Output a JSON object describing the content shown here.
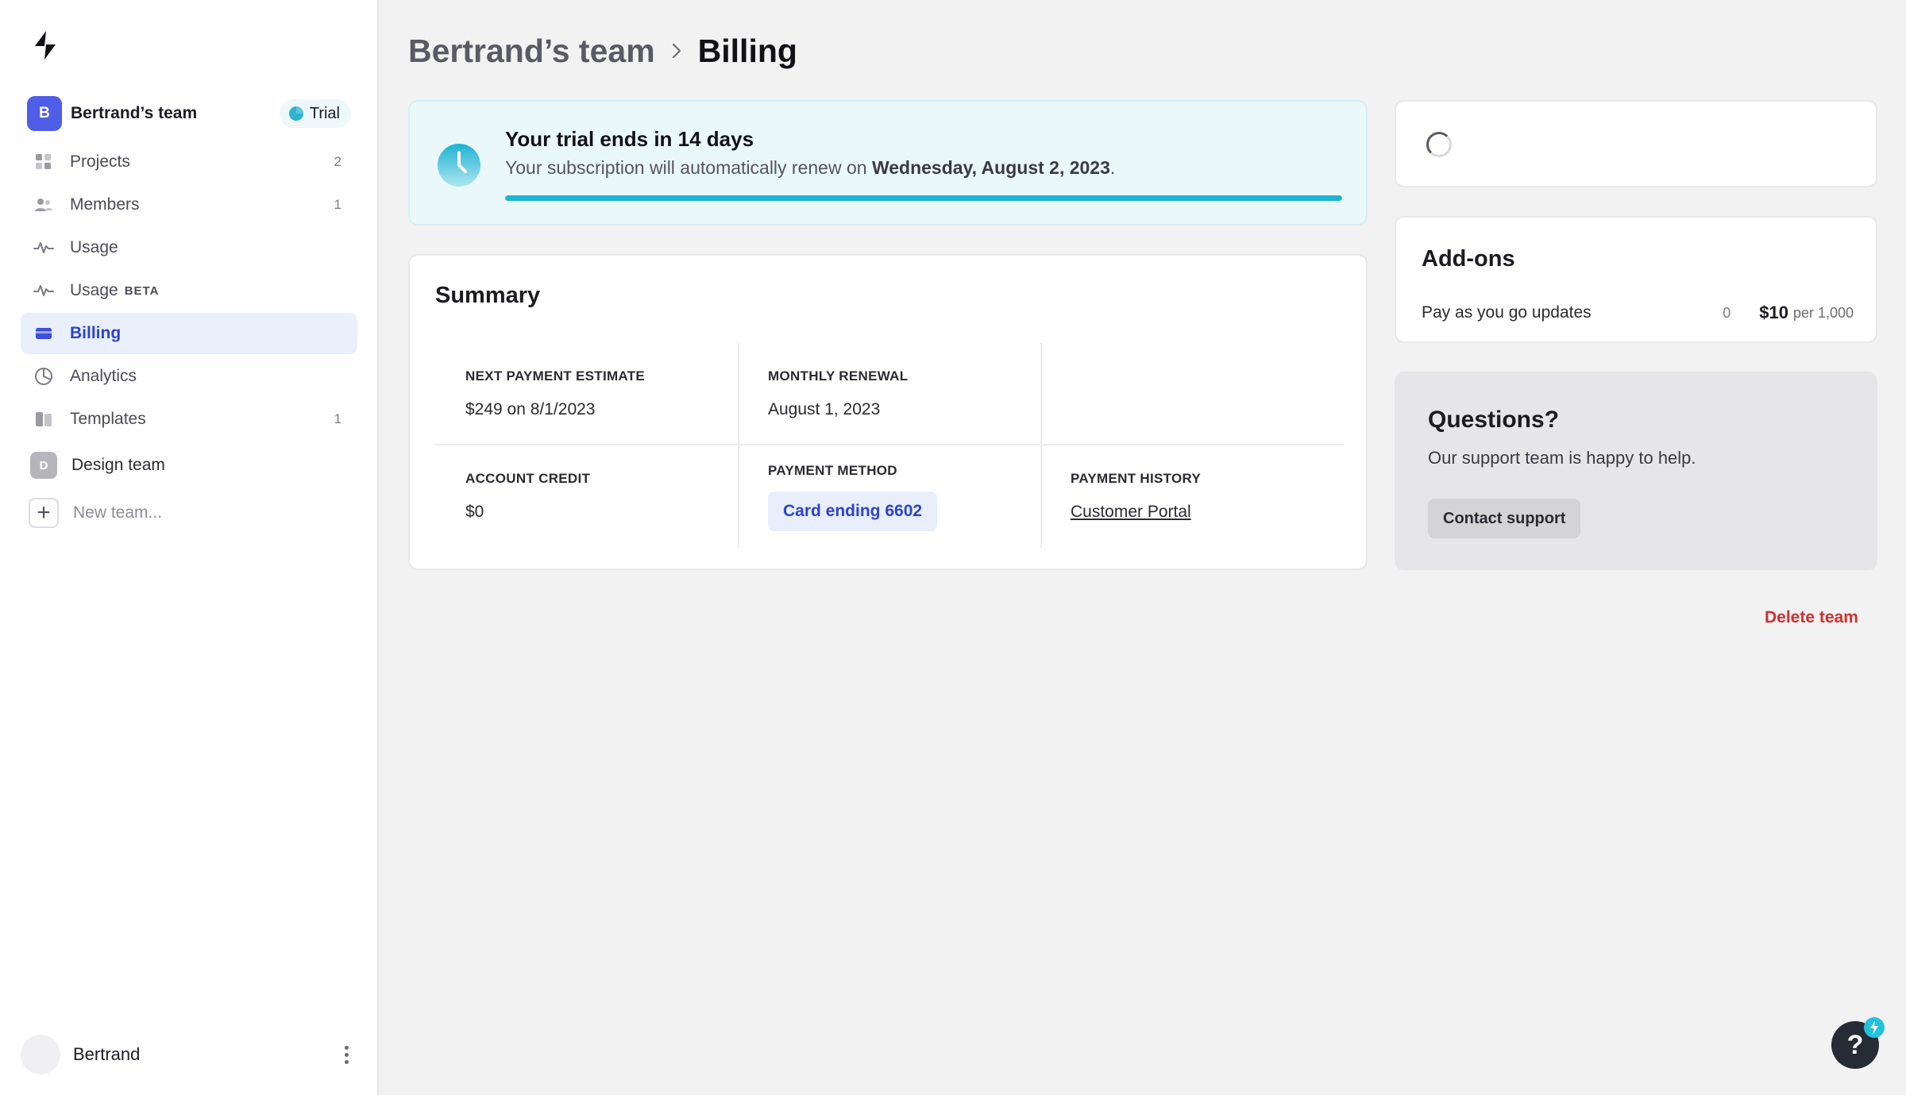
{
  "sidebar": {
    "team": {
      "initial": "B",
      "name": "Bertrand’s team",
      "badge": "Trial"
    },
    "items": [
      {
        "label": "Projects",
        "icon": "grid-icon",
        "count": "2"
      },
      {
        "label": "Members",
        "icon": "users-icon",
        "count": "1"
      },
      {
        "label": "Usage",
        "icon": "activity-icon",
        "count": ""
      },
      {
        "label": "Usage",
        "icon": "activity-icon",
        "beta": "BETA",
        "count": ""
      },
      {
        "label": "Billing",
        "icon": "credit-card-icon",
        "count": "",
        "active": true
      },
      {
        "label": "Analytics",
        "icon": "pie-chart-icon",
        "count": ""
      },
      {
        "label": "Templates",
        "icon": "templates-icon",
        "count": "1"
      }
    ],
    "other_team": {
      "initial": "D",
      "name": "Design team"
    },
    "new_team_label": "New team...",
    "user": {
      "name": "Bertrand"
    }
  },
  "breadcrumb": {
    "parent": "Bertrand’s team",
    "current": "Billing"
  },
  "trial": {
    "title": "Your trial ends in 14 days",
    "subtitle_prefix": "Your subscription will automatically renew on ",
    "renew_date": "Wednesday, August 2, 2023",
    "subtitle_suffix": ".",
    "progress_fraction": 1.0
  },
  "summary": {
    "title": "Summary",
    "next_payment": {
      "label": "NEXT PAYMENT ESTIMATE",
      "value": "$249 on 8/1/2023"
    },
    "monthly_renewal": {
      "label": "MONTHLY RENEWAL",
      "value": "August 1, 2023"
    },
    "account_credit": {
      "label": "ACCOUNT CREDIT",
      "value": "$0"
    },
    "payment_method": {
      "label": "PAYMENT METHOD",
      "value": "Card ending 6602"
    },
    "payment_history": {
      "label": "PAYMENT HISTORY",
      "value": "Customer Portal"
    }
  },
  "addons": {
    "title": "Add-ons",
    "items": [
      {
        "name": "Pay as you go updates",
        "quantity": "0",
        "price": "$10",
        "unit": "per 1,000"
      }
    ]
  },
  "questions": {
    "title": "Questions?",
    "text": "Our support team is happy to help.",
    "button": "Contact support"
  },
  "delete_team_label": "Delete team",
  "help_label": "?",
  "colors": {
    "accent": "#2f43c9",
    "team_avatar": "#4f5ee6",
    "trial_progress": "#1eb5d4",
    "danger": "#d0312d"
  }
}
